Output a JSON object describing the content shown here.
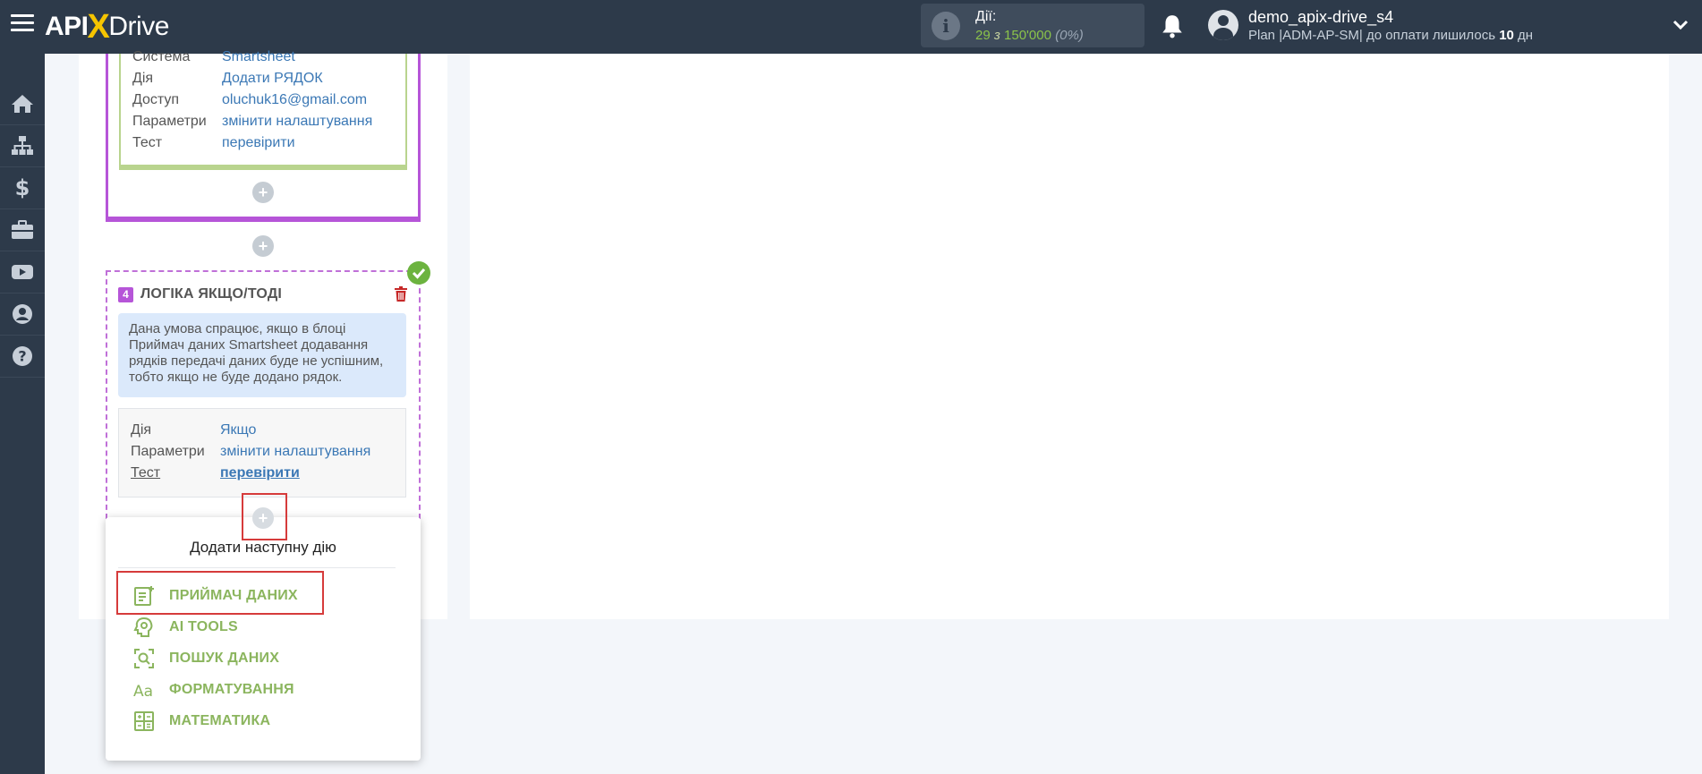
{
  "header": {
    "logo": {
      "api": "API",
      "x": "X",
      "drive": "Drive"
    },
    "actions": {
      "label": "Дії:",
      "used": "29",
      "of": "з",
      "total": "150'000",
      "percent": "(0%)"
    },
    "user": {
      "name": "demo_apix-drive_s4",
      "plan_prefix": "Plan |ADM-AP-SM| до оплати лишилось ",
      "days": "10",
      "days_suffix": " дн"
    }
  },
  "sidebar": {
    "items": [
      "home-icon",
      "sitemap-icon",
      "dollar-icon",
      "briefcase-icon",
      "youtube-icon",
      "user-circle-icon",
      "help-icon"
    ]
  },
  "prev_block": {
    "rows": [
      {
        "key": "Система",
        "value": "Smartsheet"
      },
      {
        "key": "Дія",
        "value": "Додати РЯДОК"
      },
      {
        "key": "Доступ",
        "value": "oluchuk16@gmail.com"
      },
      {
        "key": "Параметри",
        "value": "змінити налаштування"
      },
      {
        "key": "Тест",
        "value": "перевірити"
      }
    ]
  },
  "logic_block": {
    "step": "4",
    "title": "ЛОГІКА ЯКЩО/ТОДІ",
    "description": [
      "Дана умова спрацює, якщо в блоці",
      "Приймач даних Smartsheet додавання",
      "рядків передачі даних буде не успішним,",
      "тобто якщо не буде додано рядок."
    ],
    "rows": [
      {
        "key": "Дія",
        "value": "Якщо"
      },
      {
        "key": "Параметри",
        "value": "змінити налаштування"
      },
      {
        "key": "Тест",
        "value": "перевірити"
      }
    ]
  },
  "popup": {
    "title": "Додати наступну дію",
    "items": [
      {
        "label": "ПРИЙМАЧ ДАНИХ",
        "icon": "data-receiver-icon"
      },
      {
        "label": "AI TOOLS",
        "icon": "ai-brain-icon"
      },
      {
        "label": "ПОШУК ДАНИХ",
        "icon": "search-data-icon"
      },
      {
        "label": "ФОРМАТУВАННЯ",
        "icon": "formatting-icon"
      },
      {
        "label": "МАТЕМАТИКА",
        "icon": "math-icon"
      }
    ]
  },
  "plus_symbol": "+",
  "colors": {
    "topbar": "#2d3a4a",
    "accent_green": "#8bb55e",
    "accent_purple": "#b655d8",
    "link_blue": "#3b78b5",
    "highlight_red": "#d63b3b"
  }
}
